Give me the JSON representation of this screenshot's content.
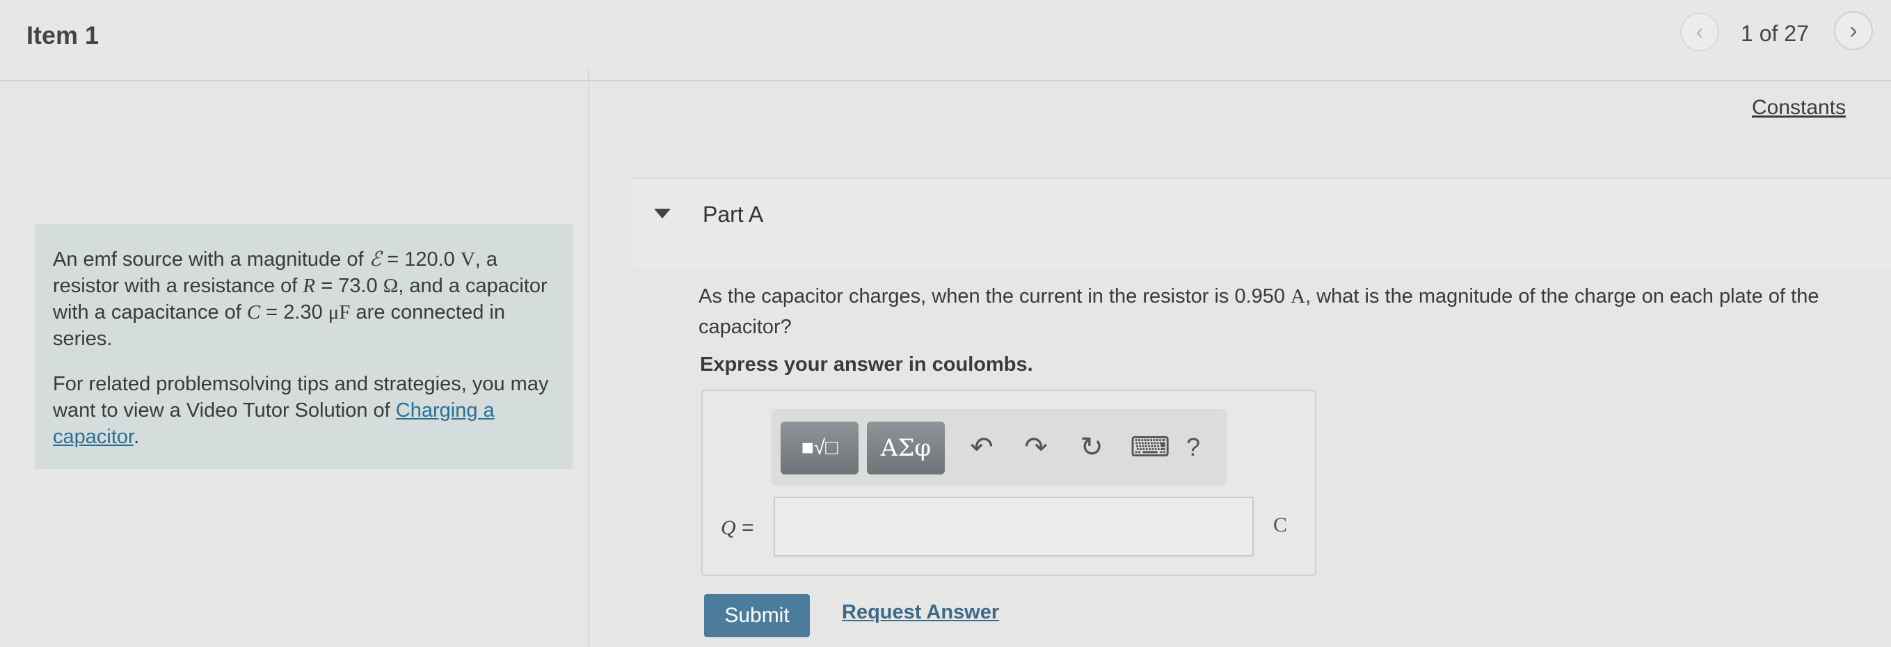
{
  "header": {
    "item_title": "Item 1",
    "page_count": "1 of 27",
    "prev_icon": "chevron-left-icon",
    "next_icon": "chevron-right-icon"
  },
  "intro": {
    "p1_a": "An emf source with a magnitude of ",
    "p1_emf_symbol": "ℰ",
    "p1_emf_value": " = 120.0 ",
    "p1_emf_unit": "V",
    "p1_b": ", a resistor with a resistance of ",
    "p1_r_symbol": "R",
    "p1_r_value": " = 73.0 ",
    "p1_r_unit": "Ω",
    "p1_c": ", and a capacitor with a capacitance of ",
    "p1_c_symbol": "C",
    "p1_c_value": " = 2.30 ",
    "p1_c_unit": "μF",
    "p1_d": " are connected in series.",
    "p2_a": "For related problemsolving tips and strategies, you may want to view a Video Tutor Solution of ",
    "p2_link": "Charging a capacitor",
    "p2_end": "."
  },
  "constants_link": "Constants",
  "part": {
    "title": "Part A",
    "question_a": "As the capacitor charges, when the current in the resistor is 0.950 ",
    "question_unit": "A",
    "question_b": ", what is the magnitude of the charge on each plate of the capacitor?",
    "instruction": "Express your answer in coulombs."
  },
  "toolbar": {
    "templates_label": "■√□",
    "greek_label": "ΑΣφ",
    "undo_glyph": "↶",
    "redo_glyph": "↷",
    "reset_glyph": "↻",
    "keyboard_glyph": "⌨",
    "help_label": "?"
  },
  "answer": {
    "variable": "Q",
    "equals": " =",
    "value": "",
    "unit": "C"
  },
  "actions": {
    "submit_label": "Submit",
    "request_label": "Request Answer"
  }
}
